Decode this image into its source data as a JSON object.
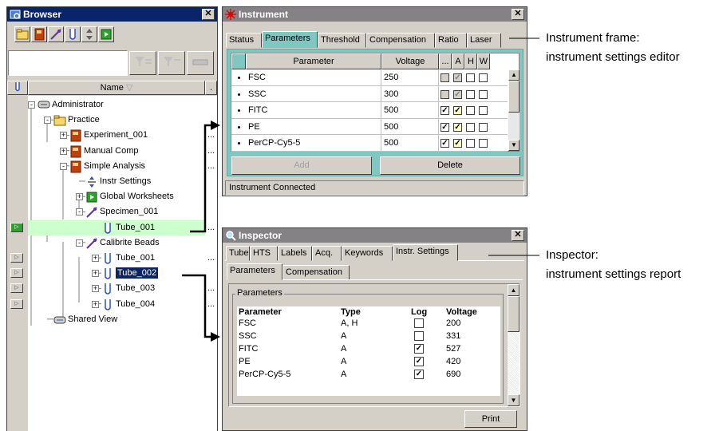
{
  "browser": {
    "title": "Browser",
    "toolbar_icons": [
      "folder-icon",
      "notebook-icon",
      "specimen-icon",
      "tube-icon",
      "sort-icon",
      "worksheet-icon"
    ],
    "column_header": "Name",
    "tree": [
      {
        "label": "Administrator",
        "icon": "database-icon"
      },
      {
        "label": "Practice",
        "icon": "folder-icon"
      },
      {
        "label": "Experiment_001",
        "icon": "experiment-icon"
      },
      {
        "label": "Manual Comp",
        "icon": "experiment-icon"
      },
      {
        "label": "Simple Analysis",
        "icon": "experiment-icon"
      },
      {
        "label": "Instr Settings",
        "icon": "settings-icon"
      },
      {
        "label": "Global Worksheets",
        "icon": "worksheet-icon"
      },
      {
        "label": "Specimen_001",
        "icon": "specimen-icon"
      },
      {
        "label": "Tube_001",
        "icon": "tube-icon"
      },
      {
        "label": "Calibrite Beads",
        "icon": "specimen-icon"
      },
      {
        "label": "Tube_001",
        "icon": "tube-icon"
      },
      {
        "label": "Tube_002",
        "icon": "tube-icon"
      },
      {
        "label": "Tube_003",
        "icon": "tube-icon"
      },
      {
        "label": "Tube_004",
        "icon": "tube-icon"
      },
      {
        "label": "Shared View",
        "icon": "shared-view-icon"
      }
    ],
    "ellipsis": "..."
  },
  "instrument": {
    "title": "Instrument",
    "tabs": [
      "Status",
      "Parameters",
      "Threshold",
      "Compensation",
      "Ratio",
      "Laser"
    ],
    "columns": [
      "Parameter",
      "Voltage",
      "...",
      "A",
      "H",
      "W"
    ],
    "rows": [
      {
        "param": "FSC",
        "voltage": "250",
        "log": false,
        "a": true,
        "h": false,
        "w": false
      },
      {
        "param": "SSC",
        "voltage": "300",
        "log": false,
        "a": true,
        "h": false,
        "w": false
      },
      {
        "param": "FITC",
        "voltage": "500",
        "log": true,
        "a": true,
        "h": false,
        "w": false
      },
      {
        "param": "PE",
        "voltage": "500",
        "log": true,
        "a": true,
        "h": false,
        "w": false
      },
      {
        "param": "PerCP-Cy5-5",
        "voltage": "500",
        "log": true,
        "a": true,
        "h": false,
        "w": false
      }
    ],
    "add_label": "Add",
    "delete_label": "Delete",
    "status": "Instrument Connected"
  },
  "inspector": {
    "title": "Inspector",
    "tabs": [
      "Tube",
      "HTS",
      "Labels",
      "Acq.",
      "Keywords",
      "Instr. Settings"
    ],
    "subtabs": [
      "Parameters",
      "Compensation"
    ],
    "group_label": "Parameters",
    "columns": [
      "Parameter",
      "Type",
      "Log",
      "Voltage"
    ],
    "rows": [
      {
        "param": "FSC",
        "type": "A, H",
        "log": false,
        "voltage": "200"
      },
      {
        "param": "SSC",
        "type": "A",
        "log": false,
        "voltage": "331"
      },
      {
        "param": "FITC",
        "type": "A",
        "log": true,
        "voltage": "527"
      },
      {
        "param": "PE",
        "type": "A",
        "log": true,
        "voltage": "420"
      },
      {
        "param": "PerCP-Cy5-5",
        "type": "A",
        "log": true,
        "voltage": "690"
      }
    ],
    "print_label": "Print"
  },
  "callouts": {
    "instrument_line1": "Instrument frame:",
    "instrument_line2": "instrument settings editor",
    "inspector_line1": "Inspector:",
    "inspector_line2": "instrument settings report"
  },
  "colors": {
    "selection": "#0a246a",
    "teal_frame": "#7fc7c0",
    "highlight_green": "#ccffcc",
    "title_inactive": "#848284"
  }
}
